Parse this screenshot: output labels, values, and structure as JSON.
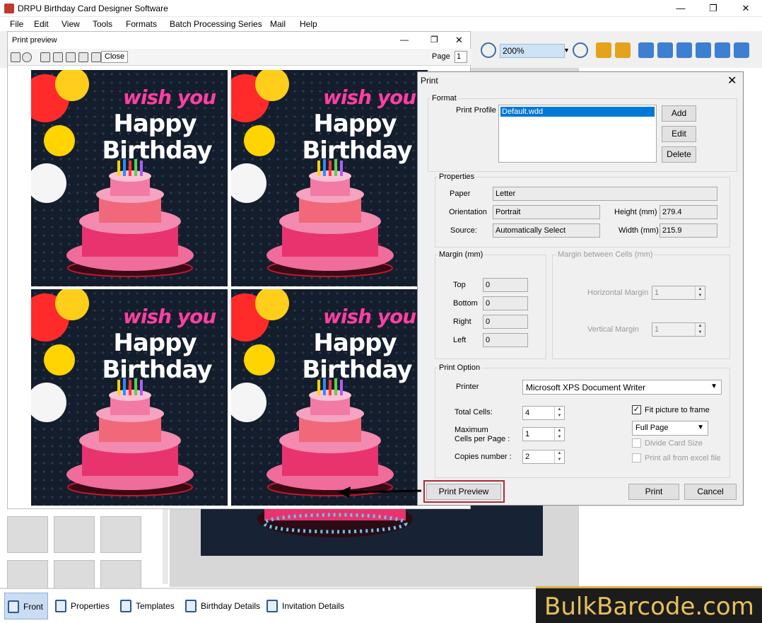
{
  "app": {
    "title": "DRPU Birthday Card Designer Software",
    "minimize": "—",
    "maximize": "❐",
    "close": "✕"
  },
  "menu": [
    "File",
    "Edit",
    "View",
    "Tools",
    "Formats",
    "Batch Processing Series",
    "Mail",
    "Help"
  ],
  "toolbar": {
    "zoom": "200%"
  },
  "print_preview": {
    "title": "Print preview",
    "close_label": "Close",
    "page_label": "Page",
    "page_value": "1",
    "card": {
      "line1": "wish you",
      "line2": "Happy",
      "line3": "Birthday"
    }
  },
  "print_dialog": {
    "title": "Print",
    "format": {
      "group_label": "Format",
      "profile_label": "Print Profile",
      "profile_selected": "Default.wdd",
      "add": "Add",
      "edit": "Edit",
      "delete": "Delete"
    },
    "properties": {
      "group_label": "Properties",
      "paper_label": "Paper",
      "paper": "Letter",
      "orientation_label": "Orientation",
      "orientation": "Portrait",
      "source_label": "Source:",
      "source": "Automatically Select",
      "height_label": "Height (mm)",
      "height": "279.4",
      "width_label": "Width (mm)",
      "width": "215.9"
    },
    "margin": {
      "group_label": "Margin (mm)",
      "top_label": "Top",
      "top": "0",
      "bottom_label": "Bottom",
      "bottom": "0",
      "right_label": "Right",
      "right": "0",
      "left_label": "Left",
      "left": "0"
    },
    "cell_margin": {
      "group_label": "Margin between Cells (mm)",
      "horizontal_label": "Horizontal Margin",
      "horizontal": "1",
      "vertical_label": "Vertical Margin",
      "vertical": "1"
    },
    "print_option": {
      "group_label": "Print Option",
      "printer_label": "Printer",
      "printer": "Microsoft XPS Document Writer",
      "total_cells_label": "Total Cells:",
      "total_cells": "4",
      "max_cells_label_1": "Maximum",
      "max_cells_label_2": "Cells per Page :",
      "max_cells": "1",
      "copies_label": "Copies number :",
      "copies": "2",
      "fit_label": "Fit picture to frame",
      "fit_checked": true,
      "fit_mode": "Full Page",
      "divide_label": "Divide Card Size",
      "excel_label": "Print all from excel file"
    },
    "buttons": {
      "preview": "Print Preview",
      "print": "Print",
      "cancel": "Cancel"
    }
  },
  "bottom_tabs": [
    "Front",
    "Properties",
    "Templates",
    "Birthday Details",
    "Invitation Details"
  ],
  "brand": "BulkBarcode.com",
  "colors": {
    "accent_red": "#c0392b",
    "card_bg": "#141d2c",
    "brand_gold": "#e7c15a"
  }
}
